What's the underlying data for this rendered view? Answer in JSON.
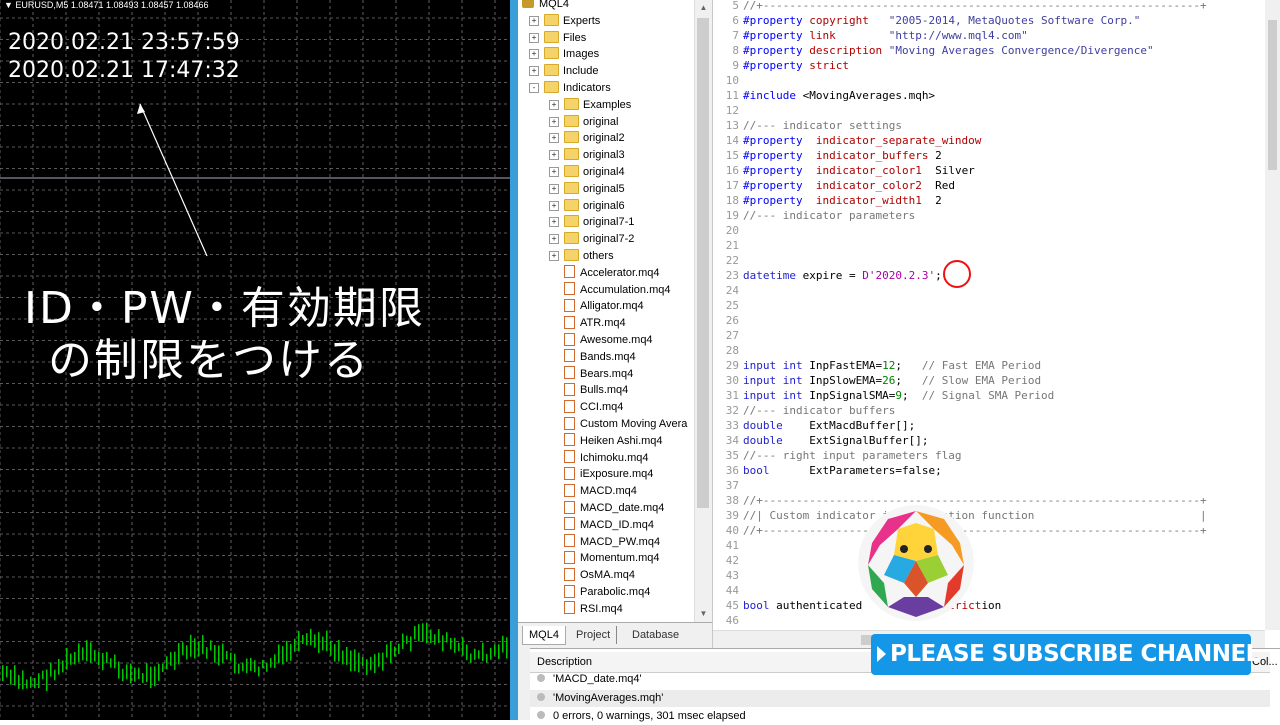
{
  "chart": {
    "symbol_bar": "▼ EURUSD,M5  1.08471 1.08493 1.08457 1.08466",
    "time_1": "2020.02.21 23:57:59",
    "time_2": "2020.02.21 17:47:32",
    "annotation_line1": "ID・PW・有効期限",
    "annotation_line2": "の制限をつける"
  },
  "navigator": {
    "root": "MQL4",
    "folders": [
      "Experts",
      "Files",
      "Images",
      "Include",
      "Indicators"
    ],
    "indicator_subfolders": [
      "Examples",
      "original",
      "original2",
      "original3",
      "original4",
      "original5",
      "original6",
      "original7-1",
      "original7-2",
      "others"
    ],
    "files": [
      "Accelerator.mq4",
      "Accumulation.mq4",
      "Alligator.mq4",
      "ATR.mq4",
      "Awesome.mq4",
      "Bands.mq4",
      "Bears.mq4",
      "Bulls.mq4",
      "CCI.mq4",
      "Custom Moving Avera",
      "Heiken Ashi.mq4",
      "Ichimoku.mq4",
      "iExposure.mq4",
      "MACD.mq4",
      "MACD_date.mq4",
      "MACD_ID.mq4",
      "MACD_PW.mq4",
      "Momentum.mq4",
      "OsMA.mq4",
      "Parabolic.mq4",
      "RSI.mq4"
    ],
    "tabs": [
      "MQL4",
      "Project",
      "Database"
    ]
  },
  "editor": {
    "lines": [
      {
        "n": "5",
        "t": "//+------------------------------------------------------------------+"
      },
      {
        "n": "6",
        "t": "#property copyright   \"2005-2014, MetaQuotes Software Corp.\""
      },
      {
        "n": "7",
        "t": "#property link        \"http://www.mql4.com\""
      },
      {
        "n": "8",
        "t": "#property description \"Moving Averages Convergence/Divergence\""
      },
      {
        "n": "9",
        "t": "#property strict"
      },
      {
        "n": "10",
        "t": ""
      },
      {
        "n": "11",
        "t": "#include <MovingAverages.mqh>"
      },
      {
        "n": "12",
        "t": ""
      },
      {
        "n": "13",
        "t": "//--- indicator settings"
      },
      {
        "n": "14",
        "t": "#property  indicator_separate_window"
      },
      {
        "n": "15",
        "t": "#property  indicator_buffers 2"
      },
      {
        "n": "16",
        "t": "#property  indicator_color1  Silver"
      },
      {
        "n": "17",
        "t": "#property  indicator_color2  Red"
      },
      {
        "n": "18",
        "t": "#property  indicator_width1  2"
      },
      {
        "n": "19",
        "t": "//--- indicator parameters"
      },
      {
        "n": "20",
        "t": ""
      },
      {
        "n": "21",
        "t": ""
      },
      {
        "n": "22",
        "t": ""
      },
      {
        "n": "23",
        "t": "datetime expire = D'2020.2.3';"
      },
      {
        "n": "24",
        "t": ""
      },
      {
        "n": "25",
        "t": ""
      },
      {
        "n": "26",
        "t": ""
      },
      {
        "n": "27",
        "t": ""
      },
      {
        "n": "28",
        "t": ""
      },
      {
        "n": "29",
        "t": "input int InpFastEMA=12;   // Fast EMA Period"
      },
      {
        "n": "30",
        "t": "input int InpSlowEMA=26;   // Slow EMA Period"
      },
      {
        "n": "31",
        "t": "input int InpSignalSMA=9;  // Signal SMA Period"
      },
      {
        "n": "32",
        "t": "//--- indicator buffers"
      },
      {
        "n": "33",
        "t": "double    ExtMacdBuffer[];"
      },
      {
        "n": "34",
        "t": "double    ExtSignalBuffer[];"
      },
      {
        "n": "35",
        "t": "//--- right input parameters flag"
      },
      {
        "n": "36",
        "t": "bool      ExtParameters=false;"
      },
      {
        "n": "37",
        "t": ""
      },
      {
        "n": "38",
        "t": "//+------------------------------------------------------------------+"
      },
      {
        "n": "39",
        "t": "//| Custom indicator initialization function                         |"
      },
      {
        "n": "40",
        "t": "//+------------------------------------------------------------------+"
      },
      {
        "n": "41",
        "t": ""
      },
      {
        "n": "42",
        "t": ""
      },
      {
        "n": "43",
        "t": ""
      },
      {
        "n": "44",
        "t": ""
      },
      {
        "n": "45",
        "t": "bool authenticated          restriction"
      },
      {
        "n": "46",
        "t": ""
      }
    ]
  },
  "toolbox": {
    "header_description": "Description",
    "header_col": "Col...",
    "rows": [
      "'MACD_date.mq4'",
      "'MovingAverages.mqh'",
      "0 errors, 0 warnings, 301 msec elapsed"
    ]
  },
  "banner": {
    "text": "PLEASE SUBSCRIBE CHANNEL"
  },
  "colors": {
    "separator": "#3a9fd9",
    "banner": "#1597e8",
    "chart_bg": "#000000",
    "candle": "#00c800"
  }
}
